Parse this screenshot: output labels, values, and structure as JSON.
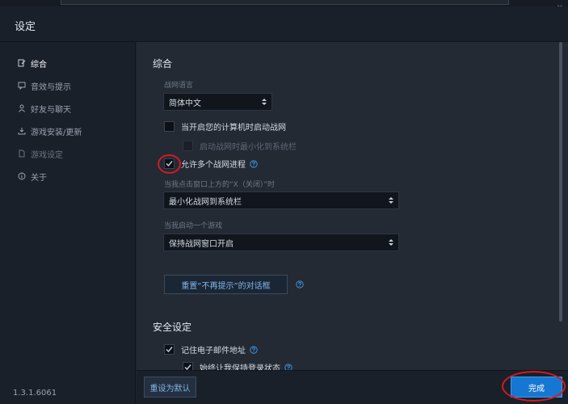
{
  "window": {
    "title": "设定",
    "close_glyph": "×"
  },
  "sidebar": {
    "items": [
      {
        "label": "综合",
        "icon": "settings-icon",
        "state": "active"
      },
      {
        "label": "音效与提示",
        "icon": "speech-icon",
        "state": "normal"
      },
      {
        "label": "好友与聊天",
        "icon": "person-icon",
        "state": "normal"
      },
      {
        "label": "游戏安装/更新",
        "icon": "download-icon",
        "state": "normal"
      },
      {
        "label": "游戏设定",
        "icon": "document-icon",
        "state": "dim"
      },
      {
        "label": "关于",
        "icon": "info-icon",
        "state": "normal"
      }
    ],
    "version": "1.3.1.6061",
    "reset_label": "重设为默认"
  },
  "general": {
    "title": "综合",
    "language_label": "战网语言",
    "language_value": "简体中文",
    "launch_on_startup_label": "当开启您的计算机时启动战网",
    "launch_on_startup_checked": false,
    "minimize_tray_label": "启动战网时最小化到系统栏",
    "minimize_tray_checked": false,
    "multi_instance_label": "允许多个战网进程",
    "multi_instance_checked": true,
    "close_label": "当我点击窗口上方的“X（关闭）”时",
    "close_value": "最小化战网到系统栏",
    "game_launch_label": "当我启动一个游戏",
    "game_launch_value": "保持战网窗口开启",
    "reset_dialogs_label": "重置“不再提示”的对话框"
  },
  "security": {
    "title": "安全设定",
    "remember_email_label": "记住电子邮件地址",
    "remember_email_checked": true,
    "stay_logged_label": "始终让我保持登录状态",
    "stay_logged_checked": true
  },
  "footer": {
    "done_label": "完成"
  },
  "colors": {
    "accent": "#1677d2",
    "link": "#7fb6ea",
    "annotation": "#d8191f"
  }
}
